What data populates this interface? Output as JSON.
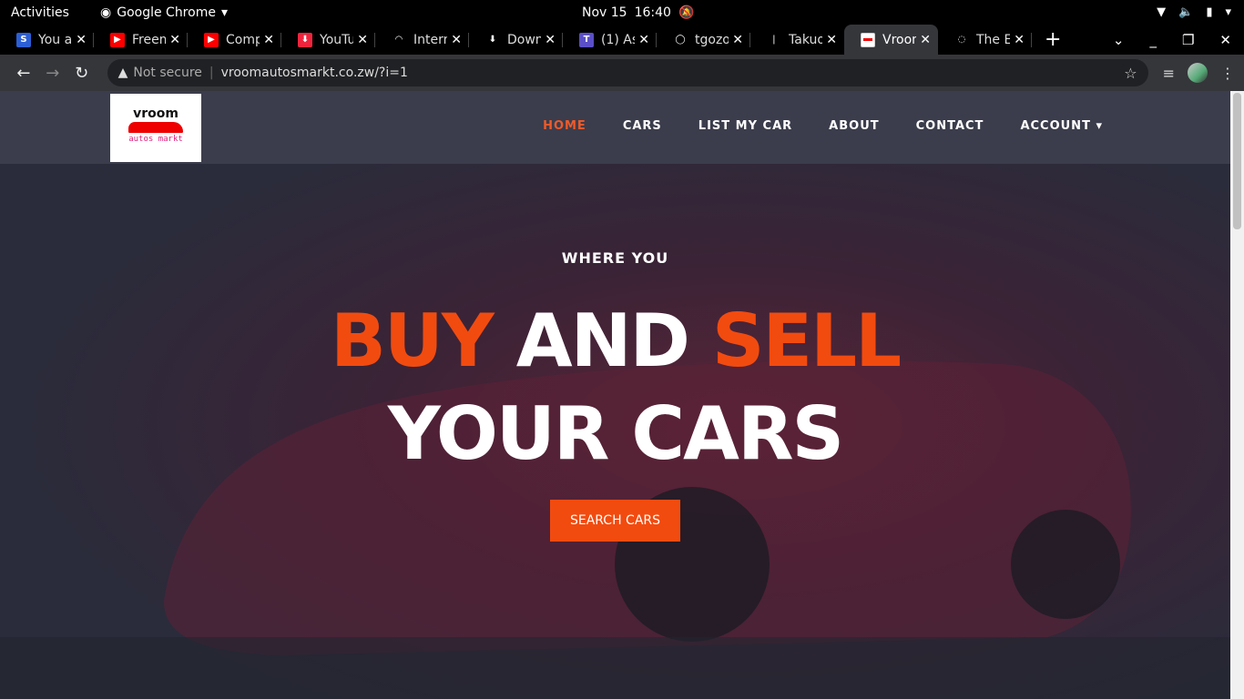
{
  "system": {
    "activities": "Activities",
    "app": "Google Chrome",
    "date": "Nov 15",
    "time": "16:40"
  },
  "tabs": [
    {
      "title": "You a",
      "color": "#2c5fd6",
      "glyph": "S"
    },
    {
      "title": "Freem",
      "color": "#ff0000",
      "glyph": "▶"
    },
    {
      "title": "Comp",
      "color": "#ff0000",
      "glyph": "▶"
    },
    {
      "title": "YouTu",
      "color": "#f0243c",
      "glyph": "⬇"
    },
    {
      "title": "Intern",
      "color": "#000",
      "glyph": "◠"
    },
    {
      "title": "Down",
      "color": "#000",
      "glyph": "⬇"
    },
    {
      "title": "(1) As",
      "color": "#5b4fc7",
      "glyph": "T"
    },
    {
      "title": "tgozo",
      "color": "#000",
      "glyph": "◯"
    },
    {
      "title": "Takuo",
      "color": "#000",
      "glyph": "❘"
    },
    {
      "title": "Vroom",
      "color": "#fff",
      "glyph": ""
    },
    {
      "title": "The E",
      "color": "#000",
      "glyph": "◌"
    }
  ],
  "browser": {
    "security": "Not secure",
    "url": "vroomautosmarkt.co.zw/?i=1"
  },
  "site": {
    "logo": {
      "word": "vroom",
      "sub": "autos markt"
    },
    "menu": [
      "HOME",
      "CARS",
      "LIST MY CAR",
      "ABOUT",
      "CONTACT",
      "ACCOUNT"
    ],
    "hero": {
      "kicker": "WHERE YOU",
      "buy": "BUY",
      "and": "AND",
      "sell": "SELL",
      "line2": "YOUR CARS",
      "button": "SEARCH CARS"
    },
    "accent": "#f24b0f"
  }
}
